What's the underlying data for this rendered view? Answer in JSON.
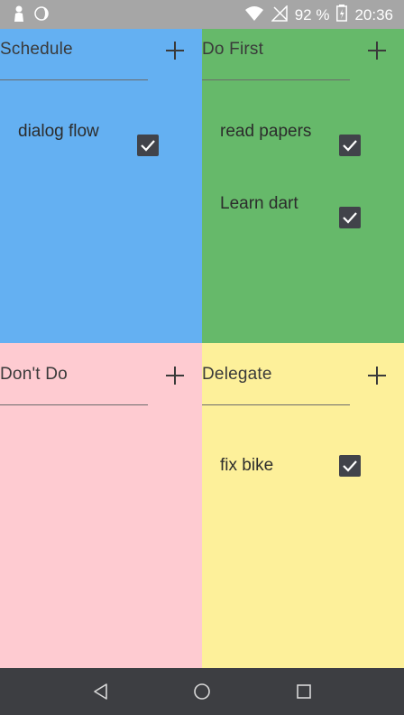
{
  "status_bar": {
    "battery_text": "92 %",
    "time": "20:36",
    "icons": [
      "person-icon",
      "moon-icon",
      "wifi-icon",
      "no-signal-icon",
      "battery-icon"
    ]
  },
  "quadrants": {
    "schedule": {
      "title": "Schedule",
      "color": "#64b0f2",
      "tasks": [
        {
          "label": "dialog flow",
          "checked": true
        }
      ]
    },
    "do_first": {
      "title": "Do First",
      "color": "#66b96a",
      "tasks": [
        {
          "label": "read papers",
          "checked": true
        },
        {
          "label": "Learn dart",
          "checked": true
        }
      ]
    },
    "dont_do": {
      "title": "Don't Do",
      "color": "#fecbd1",
      "tasks": []
    },
    "delegate": {
      "title": "Delegate",
      "color": "#fdf09a",
      "tasks": [
        {
          "label": "fix bike",
          "checked": true
        }
      ]
    }
  },
  "nav_bar": {
    "buttons": [
      "back-icon",
      "home-icon",
      "recents-icon"
    ]
  }
}
